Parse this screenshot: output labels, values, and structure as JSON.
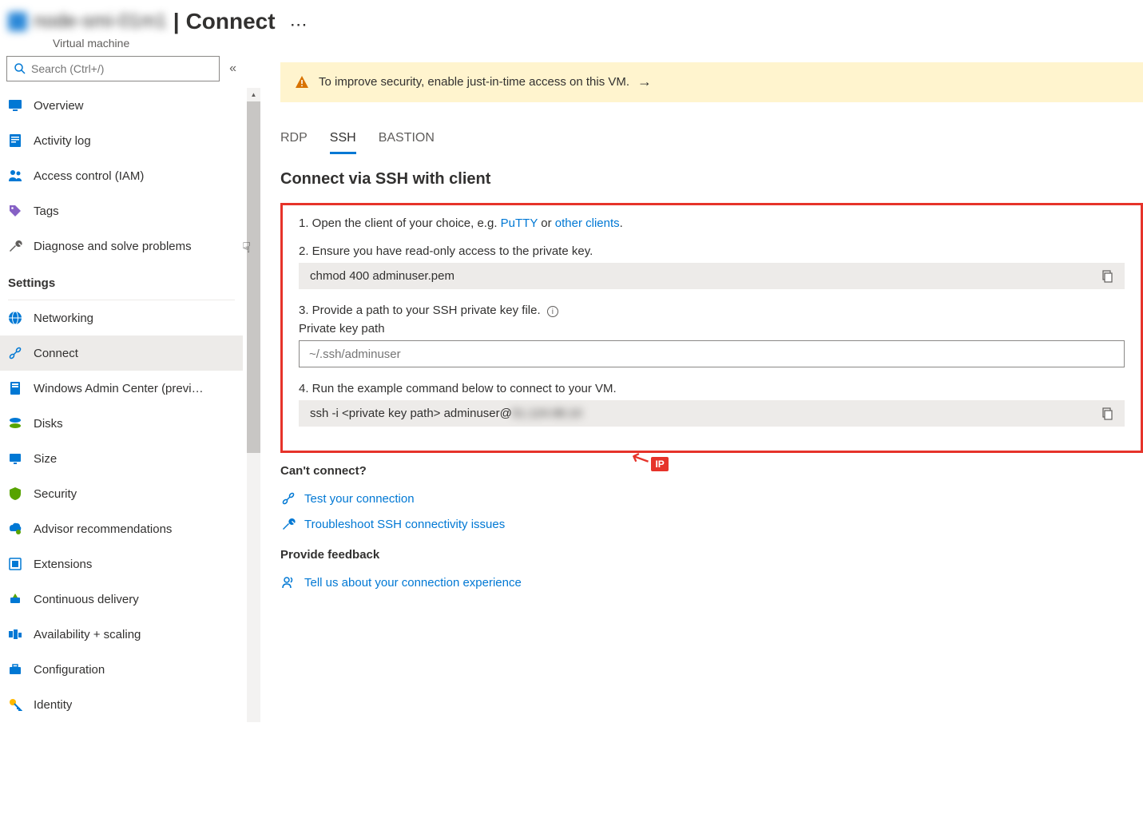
{
  "header": {
    "resource_name": "node-smi-01m1",
    "separator": "|",
    "title": "Connect",
    "subtitle": "Virtual machine"
  },
  "search": {
    "placeholder": "Search (Ctrl+/)"
  },
  "nav": {
    "overview": "Overview",
    "activity": "Activity log",
    "iam": "Access control (IAM)",
    "tags": "Tags",
    "diagnose": "Diagnose and solve problems",
    "section_settings": "Settings",
    "networking": "Networking",
    "connect": "Connect",
    "wac": "Windows Admin Center (previ…",
    "disks": "Disks",
    "size": "Size",
    "security": "Security",
    "advisor": "Advisor recommendations",
    "extensions": "Extensions",
    "cd": "Continuous delivery",
    "avail": "Availability + scaling",
    "config": "Configuration",
    "identity": "Identity"
  },
  "banner": {
    "text": "To improve security, enable just-in-time access on this VM."
  },
  "tabs": {
    "rdp": "RDP",
    "ssh": "SSH",
    "bastion": "BASTION"
  },
  "content": {
    "subhead": "Connect via SSH with client",
    "step1_prefix": "1. Open the client of your choice, e.g. ",
    "step1_link1": "PuTTY",
    "step1_mid": " or ",
    "step1_link2": "other clients",
    "step1_suffix": ".",
    "step2": "2. Ensure you have read-only access to the private key.",
    "code1": "chmod 400 adminuser.pem",
    "step3": "3. Provide a path to your SSH private key file.",
    "pk_label": "Private key path",
    "pk_placeholder": "~/.ssh/adminuser",
    "step4": "4. Run the example command below to connect to your VM.",
    "code2_prefix": "ssh -i <private key path> adminuser@",
    "code2_ip": "51.124.98.10",
    "ip_badge": "IP",
    "cant": "Can't connect?",
    "test": "Test your connection",
    "troubleshoot": "Troubleshoot SSH connectivity issues",
    "feedback_head": "Provide feedback",
    "feedback_link": "Tell us about your connection experience"
  }
}
